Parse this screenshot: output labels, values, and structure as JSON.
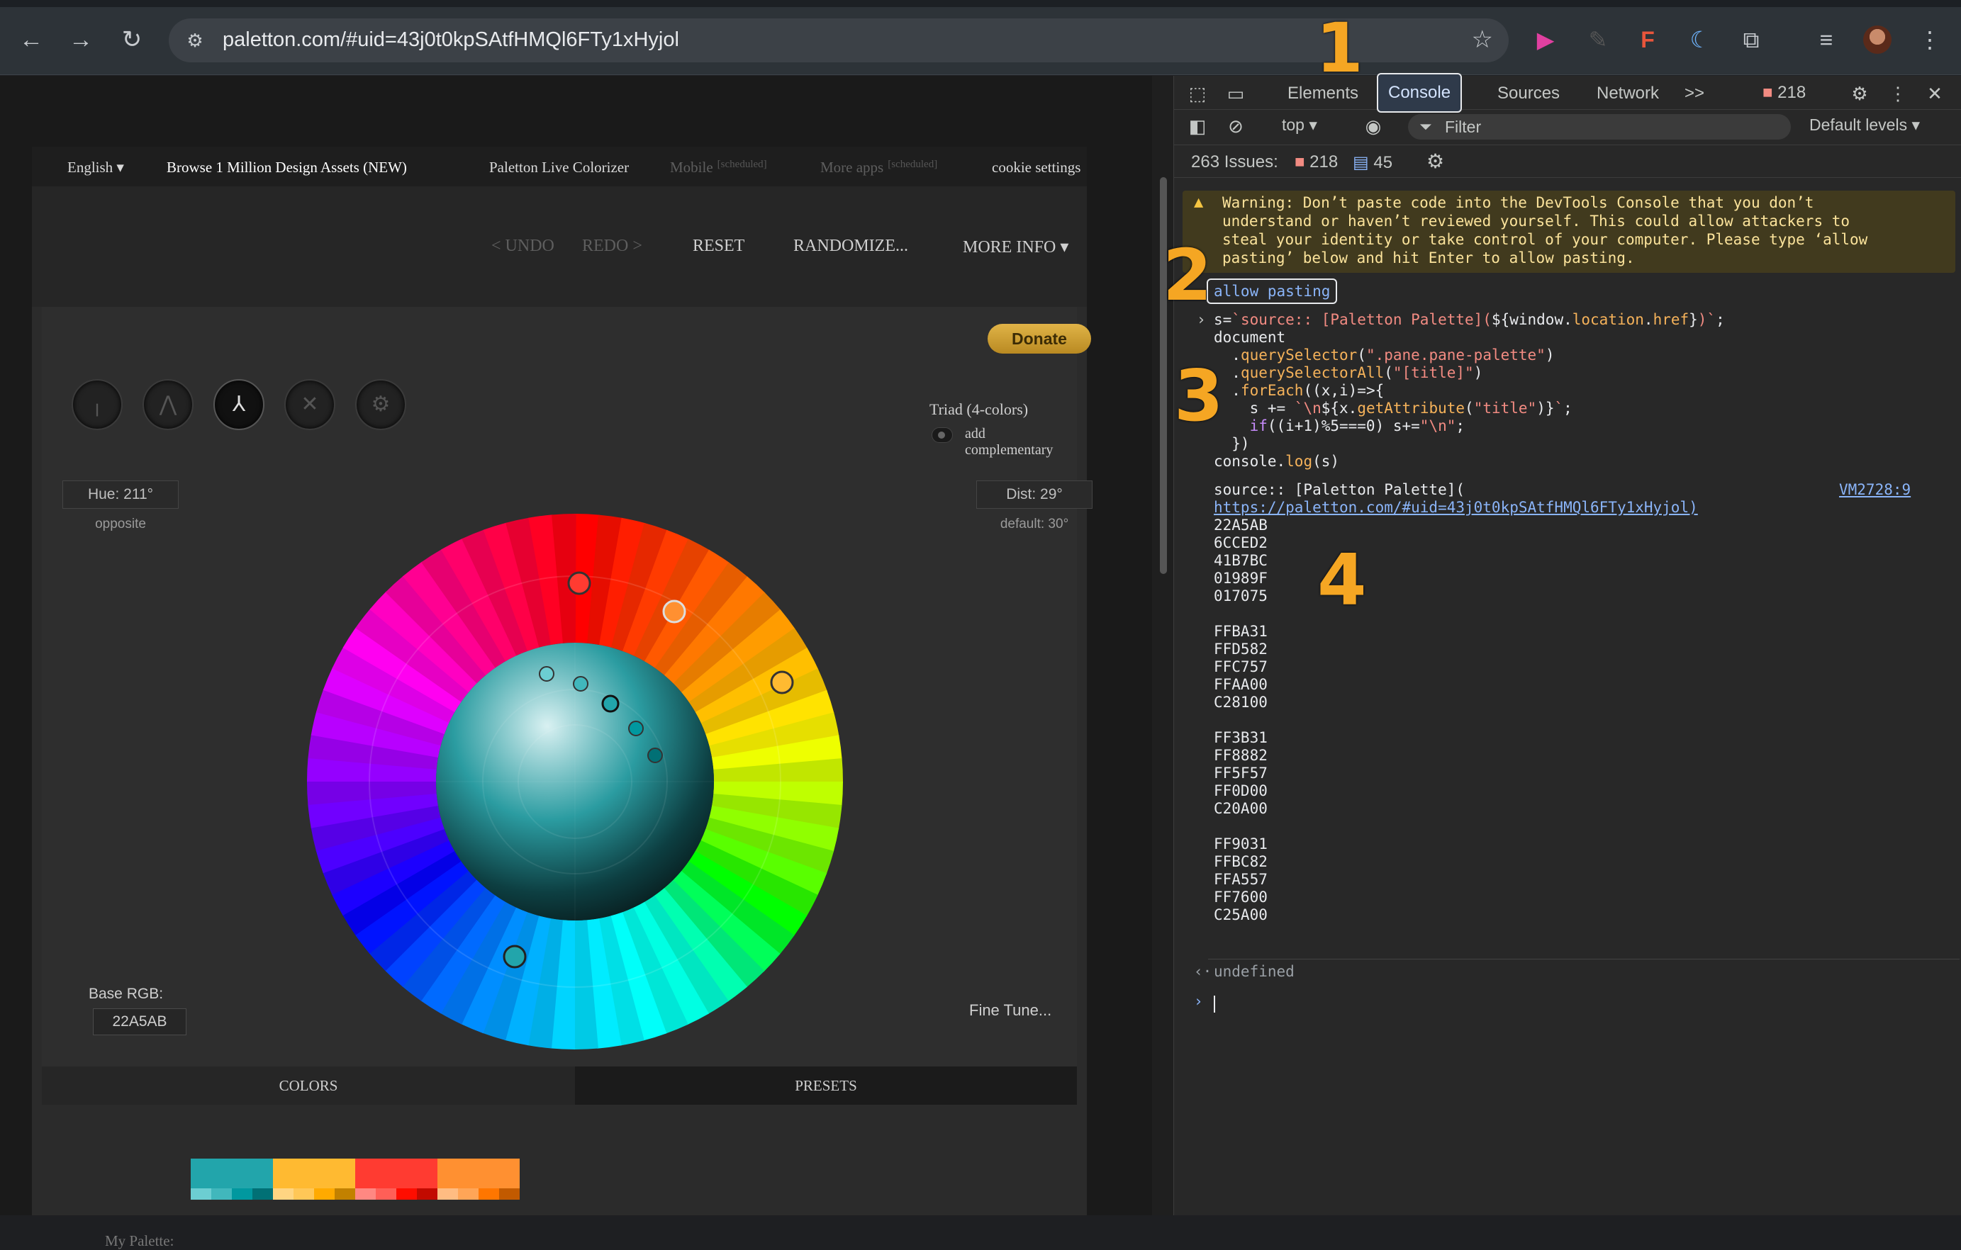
{
  "browser": {
    "url": "paletton.com/#uid=43j0t0kpSAtfHMQl6FTy1xHyjol",
    "annotations": [
      "1",
      "2",
      "3",
      "4"
    ]
  },
  "paletton": {
    "menu": {
      "language": "English",
      "browse": "Browse 1 Million Design Assets (NEW)",
      "live": "Paletton Live Colorizer",
      "mobile": "Mobile",
      "more_apps": "More apps",
      "scheduled": "[scheduled]",
      "cookie": "cookie settings"
    },
    "toolbar": {
      "undo": "< UNDO",
      "redo": "REDO >",
      "reset": "RESET",
      "randomize": "RANDOMIZE...",
      "more_info": "MORE INFO"
    },
    "donate": "Donate",
    "scheme_label": "Triad (4-colors)",
    "add_complementary": "add complementary",
    "hue": "Hue: 211°",
    "hue_sub": "opposite",
    "dist": "Dist: 29°",
    "dist_sub": "default: 30°",
    "base_rgb_label": "Base RGB:",
    "base_rgb": "22A5AB",
    "fine_tune": "Fine Tune...",
    "tabs": [
      "COLORS",
      "PRESETS"
    ],
    "my_palette": "My Palette:",
    "palette": [
      {
        "main": "#22A5AB",
        "shades": [
          "#6CCED2",
          "#41B7BC",
          "#01989F",
          "#017075"
        ]
      },
      {
        "main": "#FFBA31",
        "shades": [
          "#FFD582",
          "#FFC757",
          "#FFAA00",
          "#C28100"
        ]
      },
      {
        "main": "#FF3B31",
        "shades": [
          "#FF8882",
          "#FF5F57",
          "#FF0D00",
          "#C20A00"
        ]
      },
      {
        "main": "#FF9031",
        "shades": [
          "#FFBC82",
          "#FFA557",
          "#FF7600",
          "#C25A00"
        ]
      }
    ]
  },
  "devtools": {
    "tabs": [
      "Elements",
      "Console",
      "Sources",
      "Network"
    ],
    "active_tab": "Console",
    "more": ">>",
    "error_count": "218",
    "context": "top",
    "filter_placeholder": "Filter",
    "levels": "Default levels",
    "issues_label": "263 Issues:",
    "issues_errors": "218",
    "issues_info": "45",
    "warning": "Warning: Don’t paste code into the DevTools Console that you don’t\nunderstand or haven’t reviewed yourself. This could allow attackers to\nsteal your identity or take control of your computer. Please type ‘allow\npasting’ below and hit Enter to allow pasting.",
    "allow_pasting": "allow pasting",
    "source_line": "source:: [Paletton Palette](",
    "source_link": "https://paletton.com/#uid=43j0t0kpSAtfHMQl6FTy1xHyjol)",
    "vm_link": "VM2728:9",
    "output_colors": "22A5AB\n6CCED2\n41B7BC\n01989F\n017075\n\nFFBA31\nFFD582\nFFC757\nFFAA00\nC28100\n\nFF3B31\nFF8882\nFF5F57\nFF0D00\nC20A00\n\nFF9031\nFFBC82\nFFA557\nFF7600\nC25A00",
    "return_value": "undefined"
  }
}
